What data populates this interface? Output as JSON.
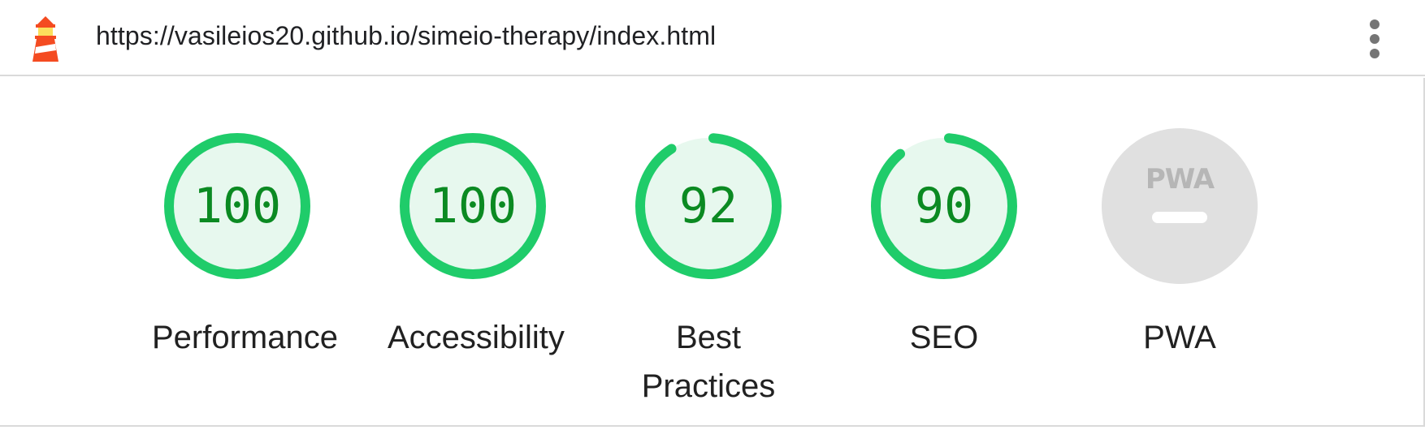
{
  "header": {
    "url": "https://vasileios20.github.io/simeio-therapy/index.html",
    "logo_icon": "lighthouse-icon",
    "menu_icon": "more-vert-icon"
  },
  "colors": {
    "pass_stroke": "#1fcc6a",
    "pass_fill": "#e7f8ee",
    "pass_text": "#0b8a22",
    "na_fill": "#e0e0e0",
    "na_mark": "#ffffff",
    "na_logo": "#b6b6b6"
  },
  "gauges": [
    {
      "score": 100,
      "score_label": "100",
      "label": "Performance"
    },
    {
      "score": 100,
      "score_label": "100",
      "label": "Accessibility"
    },
    {
      "score": 92,
      "score_label": "92",
      "label": "Best Practices"
    },
    {
      "score": 90,
      "score_label": "90",
      "label": "SEO"
    }
  ],
  "pwa": {
    "label": "PWA",
    "badge_text": "PWA",
    "status": "not-applicable"
  }
}
